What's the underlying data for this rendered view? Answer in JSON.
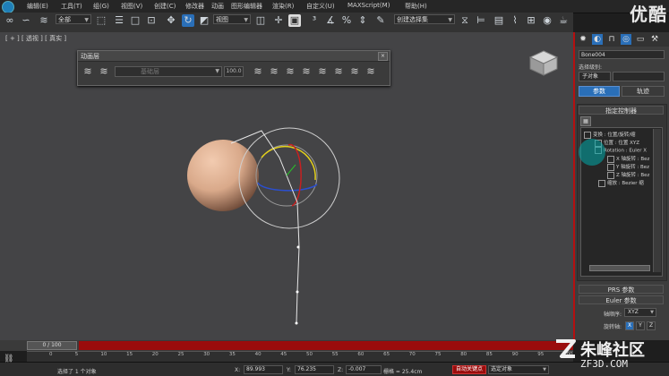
{
  "menu": {
    "items": [
      "编辑(E)",
      "工具(T)",
      "组(G)",
      "视图(V)",
      "创建(C)",
      "修改器",
      "动画",
      "图形编辑器",
      "渲染(R)",
      "自定义(U)",
      "MAXScript(M)",
      "帮助(H)"
    ]
  },
  "toolbar": {
    "filter_value": "全部",
    "refcoord_value": "视图",
    "named_selection_value": "创建选择集"
  },
  "brand_top": "优酷",
  "viewport": {
    "label": "[ + ] [ 透视 ] [ 真实 ]"
  },
  "layer_panel": {
    "title": "动画层",
    "dropdown_value": "基础层",
    "weight_value": "100.0"
  },
  "cmd_panel": {
    "object_name": "Bone004",
    "selection_level_label": "选择级别:",
    "sub_object_value": "子对象",
    "tab_params": "参数",
    "tab_track": "轨迹",
    "assign_controller_title": "指定控制器",
    "tree_items": [
      "变换 : 位置/旋转/缩",
      "位置 : 位置 XYZ",
      "Rotation : Euler X",
      "X 轴旋转 : Bez",
      "Y 轴旋转 : Bez",
      "Z 轴旋转 : Bez",
      "缩放 : Bezier 缩"
    ],
    "prs_title": "PRS 参数",
    "euler_title": "Euler 参数",
    "axis_order_label": "轴顺序:",
    "axis_order_value": "XYZ",
    "axis_label": "旋转轴:",
    "axis_x": "X",
    "axis_y": "Y",
    "axis_z": "Z"
  },
  "timeline": {
    "slider_text": "0 / 100",
    "ticks": [
      "0",
      "5",
      "10",
      "15",
      "20",
      "25",
      "30",
      "35",
      "40",
      "45",
      "50",
      "55",
      "60",
      "65",
      "70",
      "75",
      "80",
      "85",
      "90",
      "95",
      "100"
    ]
  },
  "status": {
    "selection_text": "选择了 1 个对象",
    "x_label": "X:",
    "x_value": "89.993",
    "y_label": "Y:",
    "y_value": "76.235",
    "z_label": "Z:",
    "z_value": "-0.007",
    "grid_text": "栅格 = 25.4cm",
    "autokey_label": "自动关键点",
    "selection_set_value": "选定对象"
  },
  "brand_bottom": {
    "name": "朱峰社区",
    "url": "ZF3D.COM"
  },
  "colors": {
    "accent_blue": "#2a6fb8",
    "autokey_red": "#9a0c0c",
    "viewport_gray": "#444446",
    "sphere": "#d9a98a"
  }
}
